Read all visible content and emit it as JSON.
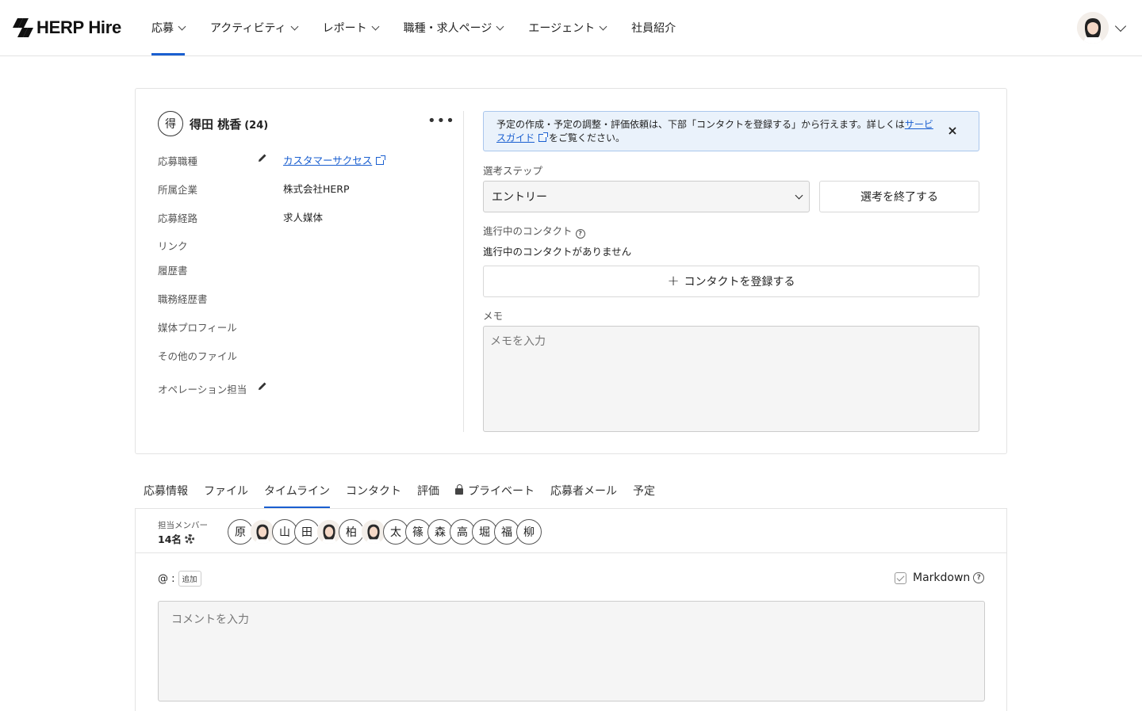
{
  "header": {
    "logo_text": "HERP Hire",
    "nav": [
      {
        "label": "応募",
        "dropdown": true,
        "active": true
      },
      {
        "label": "アクティビティ",
        "dropdown": true
      },
      {
        "label": "レポート",
        "dropdown": true
      },
      {
        "label": "職種・求人ページ",
        "dropdown": true
      },
      {
        "label": "エージェント",
        "dropdown": true
      },
      {
        "label": "社員紹介",
        "dropdown": false
      }
    ]
  },
  "candidate": {
    "initial": "得",
    "name": "得田 桃香",
    "age": "(24)",
    "fields": [
      {
        "label": "応募職種",
        "value": "カスタマーサクセス",
        "link": true,
        "editable": true
      },
      {
        "label": "所属企業",
        "value": "株式会社HERP"
      },
      {
        "label": "応募経路",
        "value": "求人媒体"
      },
      {
        "label": "リンク",
        "value": ""
      },
      {
        "label": "履歴書",
        "value": ""
      },
      {
        "label": "職務経歴書",
        "value": ""
      },
      {
        "label": "媒体プロフィール",
        "value": ""
      },
      {
        "label": "その他のファイル",
        "value": ""
      },
      {
        "label": "オペレーション担当",
        "value": "",
        "editable": true
      }
    ]
  },
  "info": {
    "text_before": "予定の作成・予定の調整・評価依頼は、下部「コンタクトを登録する」から行えます。詳しくは",
    "link_text": "サービスガイド",
    "text_after": "をご覧ください。"
  },
  "selection": {
    "step_label": "選考ステップ",
    "step_value": "エントリー",
    "end_button": "選考を終了する",
    "contact_label": "進行中のコンタクト",
    "no_contact": "進行中のコンタクトがありません",
    "add_contact": "コンタクトを登録する",
    "memo_label": "メモ",
    "memo_placeholder": "メモを入力"
  },
  "tabs": [
    {
      "label": "応募情報"
    },
    {
      "label": "ファイル"
    },
    {
      "label": "タイムライン",
      "active": true
    },
    {
      "label": "コンタクト"
    },
    {
      "label": "評価"
    },
    {
      "label": "プライベート",
      "icon": "lock-icon"
    },
    {
      "label": "応募者メール"
    },
    {
      "label": "予定"
    }
  ],
  "timeline": {
    "members_label": "担当メンバー",
    "members_count": "14名",
    "members": [
      "原",
      "photo",
      "山",
      "田",
      "photo",
      "柏",
      "photo",
      "太",
      "篠",
      "森",
      "高",
      "堀",
      "福",
      "柳"
    ],
    "mention_prefix": "@ :",
    "add_label": "追加",
    "markdown_label": "Markdown",
    "comment_placeholder": "コメントを入力"
  },
  "colors": {
    "accent": "#1a5fd0",
    "info_bg": "#eaf2fb",
    "info_border": "#a9c6ec",
    "input_bg": "#f5f5f5"
  }
}
